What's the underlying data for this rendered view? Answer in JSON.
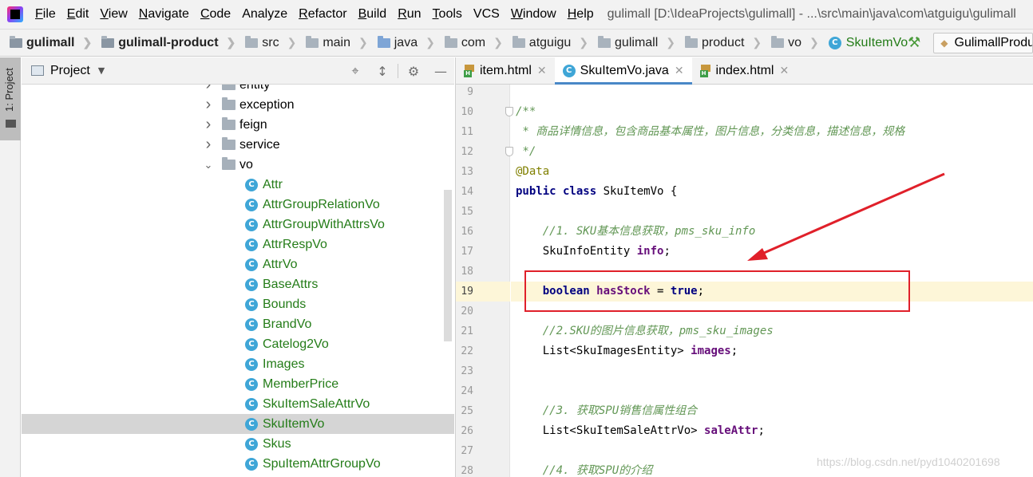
{
  "menu": {
    "items": [
      {
        "mnemonic": "F",
        "rest": "ile"
      },
      {
        "mnemonic": "E",
        "rest": "dit"
      },
      {
        "mnemonic": "V",
        "rest": "iew"
      },
      {
        "mnemonic": "N",
        "rest": "avigate"
      },
      {
        "mnemonic": "C",
        "rest": "ode"
      },
      {
        "mnemonic": "",
        "rest": "Analyze"
      },
      {
        "mnemonic": "R",
        "rest": "efactor"
      },
      {
        "mnemonic": "B",
        "rest": "uild"
      },
      {
        "mnemonic": "R",
        "rest": "un"
      },
      {
        "mnemonic": "T",
        "rest": "ools"
      },
      {
        "mnemonic": "",
        "rest": "VCS"
      },
      {
        "mnemonic": "W",
        "rest": "indow"
      },
      {
        "mnemonic": "H",
        "rest": "elp"
      }
    ],
    "window_title": "gulimall [D:\\IdeaProjects\\gulimall] - ...\\src\\main\\java\\com\\atguigu\\gulimall"
  },
  "breadcrumb": [
    {
      "label": "gulimall",
      "icon": "module-folder-icon",
      "bold": true
    },
    {
      "label": "gulimall-product",
      "icon": "module-folder-icon",
      "bold": true
    },
    {
      "label": "src",
      "icon": "folder-icon",
      "bold": false
    },
    {
      "label": "main",
      "icon": "folder-icon",
      "bold": false
    },
    {
      "label": "java",
      "icon": "source-folder-icon",
      "bold": false
    },
    {
      "label": "com",
      "icon": "folder-icon",
      "bold": false
    },
    {
      "label": "atguigu",
      "icon": "folder-icon",
      "bold": false
    },
    {
      "label": "gulimall",
      "icon": "folder-icon",
      "bold": false
    },
    {
      "label": "product",
      "icon": "folder-icon",
      "bold": false
    },
    {
      "label": "vo",
      "icon": "folder-icon",
      "bold": false
    },
    {
      "label": "SkuItemVo",
      "icon": "class-icon",
      "bold": false
    }
  ],
  "run_config": {
    "label": "GulimallProductApplication"
  },
  "left_stripe": {
    "label": "1: Project"
  },
  "project_panel": {
    "title": "Project",
    "tree": [
      {
        "label": "entity",
        "type": "folder",
        "expanded": false,
        "indent": 1
      },
      {
        "label": "exception",
        "type": "folder",
        "expanded": false,
        "indent": 1
      },
      {
        "label": "feign",
        "type": "folder",
        "expanded": false,
        "indent": 1
      },
      {
        "label": "service",
        "type": "folder",
        "expanded": false,
        "indent": 1
      },
      {
        "label": "vo",
        "type": "folder",
        "expanded": true,
        "indent": 1
      },
      {
        "label": "Attr",
        "type": "class",
        "indent": 2
      },
      {
        "label": "AttrGroupRelationVo",
        "type": "class",
        "indent": 2
      },
      {
        "label": "AttrGroupWithAttrsVo",
        "type": "class",
        "indent": 2
      },
      {
        "label": "AttrRespVo",
        "type": "class",
        "indent": 2
      },
      {
        "label": "AttrVo",
        "type": "class",
        "indent": 2
      },
      {
        "label": "BaseAttrs",
        "type": "class",
        "indent": 2
      },
      {
        "label": "Bounds",
        "type": "class",
        "indent": 2
      },
      {
        "label": "BrandVo",
        "type": "class",
        "indent": 2
      },
      {
        "label": "Catelog2Vo",
        "type": "class",
        "indent": 2
      },
      {
        "label": "Images",
        "type": "class",
        "indent": 2
      },
      {
        "label": "MemberPrice",
        "type": "class",
        "indent": 2
      },
      {
        "label": "SkuItemSaleAttrVo",
        "type": "class",
        "indent": 2
      },
      {
        "label": "SkuItemVo",
        "type": "class",
        "indent": 2,
        "selected": true
      },
      {
        "label": "Skus",
        "type": "class",
        "indent": 2
      },
      {
        "label": "SpuItemAttrGroupVo",
        "type": "class",
        "indent": 2
      }
    ]
  },
  "editor": {
    "tabs": [
      {
        "label": "item.html",
        "icon": "html-file-icon",
        "active": false
      },
      {
        "label": "SkuItemVo.java",
        "icon": "class-icon",
        "active": true
      },
      {
        "label": "index.html",
        "icon": "html-file-icon",
        "active": false
      }
    ],
    "current_line": 19,
    "lines": [
      {
        "no": 9,
        "tokens": []
      },
      {
        "no": 10,
        "fold": true,
        "tokens": [
          {
            "t": "/**",
            "c": "c-doc"
          }
        ]
      },
      {
        "no": 11,
        "tokens": [
          {
            "t": " * ",
            "c": "c-doc"
          },
          {
            "t": "商品详情信息，包含商品基本属性，图片信息，分类信息，描述信息，规格",
            "c": "c-doc-cn"
          }
        ]
      },
      {
        "no": 12,
        "fold": true,
        "tokens": [
          {
            "t": " */",
            "c": "c-doc"
          }
        ]
      },
      {
        "no": 13,
        "tokens": [
          {
            "t": "@Data",
            "c": "c-ann"
          }
        ]
      },
      {
        "no": 14,
        "tokens": [
          {
            "t": "public class ",
            "c": "c-kw"
          },
          {
            "t": "SkuItemVo {",
            "c": "c-ident"
          }
        ]
      },
      {
        "no": 15,
        "tokens": []
      },
      {
        "no": 16,
        "tokens": [
          {
            "t": "    //1. SKU基本信息获取，pms_sku_info",
            "c": "c-comment"
          }
        ]
      },
      {
        "no": 17,
        "tokens": [
          {
            "t": "    SkuInfoEntity ",
            "c": "c-ident"
          },
          {
            "t": "info",
            "c": "c-field"
          },
          {
            "t": ";",
            "c": "c-ident"
          }
        ]
      },
      {
        "no": 18,
        "tokens": []
      },
      {
        "no": 19,
        "tokens": [
          {
            "t": "    boolean ",
            "c": "c-kw"
          },
          {
            "t": "hasStock",
            "c": "c-field"
          },
          {
            "t": " = ",
            "c": "c-ident"
          },
          {
            "t": "true",
            "c": "c-kw"
          },
          {
            "t": ";",
            "c": "c-ident"
          }
        ]
      },
      {
        "no": 20,
        "tokens": []
      },
      {
        "no": 21,
        "tokens": [
          {
            "t": "    //2.SKU的图片信息获取，pms_sku_images",
            "c": "c-comment"
          }
        ]
      },
      {
        "no": 22,
        "tokens": [
          {
            "t": "    List<SkuImagesEntity> ",
            "c": "c-ident"
          },
          {
            "t": "images",
            "c": "c-field"
          },
          {
            "t": ";",
            "c": "c-ident"
          }
        ]
      },
      {
        "no": 23,
        "tokens": []
      },
      {
        "no": 24,
        "tokens": []
      },
      {
        "no": 25,
        "tokens": [
          {
            "t": "    //3. 获取SPU销售信属性组合",
            "c": "c-comment"
          }
        ]
      },
      {
        "no": 26,
        "tokens": [
          {
            "t": "    List<SkuItemSaleAttrVo> ",
            "c": "c-ident"
          },
          {
            "t": "saleAttr",
            "c": "c-field"
          },
          {
            "t": ";",
            "c": "c-ident"
          }
        ]
      },
      {
        "no": 27,
        "tokens": []
      },
      {
        "no": 28,
        "tokens": [
          {
            "t": "    //4. 获取SPU的介绍",
            "c": "c-comment"
          }
        ]
      }
    ]
  },
  "colors": {
    "annotation_red": "#e0202a",
    "selected_row": "#d5d5d5",
    "class_icon": "#3fa6d7",
    "class_name_green": "#247c18"
  },
  "watermark": "https://blog.csdn.net/pyd1040201698"
}
